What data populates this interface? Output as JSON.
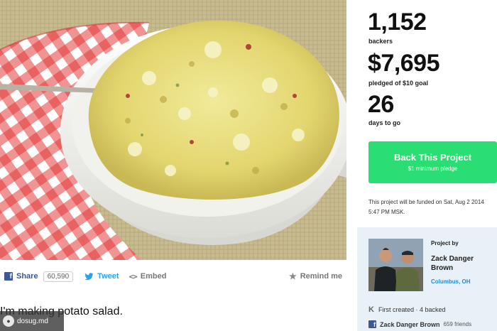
{
  "stats": {
    "backers_value": "1,152",
    "backers_label": "backers",
    "pledged_value": "$7,695",
    "pledged_label": "pledged of $10 goal",
    "days_value": "26",
    "days_label": "days to go"
  },
  "back_button": {
    "title": "Back This Project",
    "subtitle": "$1 minimum pledge",
    "color": "#2bde73"
  },
  "funding_note": "This project will be funded on Sat, Aug 2 2014 5:47 PM MSK.",
  "creator": {
    "heading": "Project by",
    "name": "Zack Danger Brown",
    "location": "Columbus, OH",
    "history": "First created · 4 backed",
    "facebook_name": "Zack Danger Brown",
    "facebook_friends": "659 friends"
  },
  "share_bar": {
    "share_label": "Share",
    "share_count": "60,590",
    "tweet_label": "Tweet",
    "embed_label": "Embed",
    "remind_label": "Remind me"
  },
  "project": {
    "title": "I'm making potato salad."
  },
  "watermark": {
    "text": "dosug.md"
  },
  "icons": {
    "facebook": "facebook-icon",
    "twitter": "twitter-icon",
    "embed": "code-icon",
    "remind": "star-icon",
    "kickstarter": "kickstarter-k-icon"
  },
  "colors": {
    "facebook": "#3b5998",
    "twitter": "#2aa3ef",
    "location_link": "#1a8fd6",
    "creator_panel": "#e8f1f7"
  }
}
